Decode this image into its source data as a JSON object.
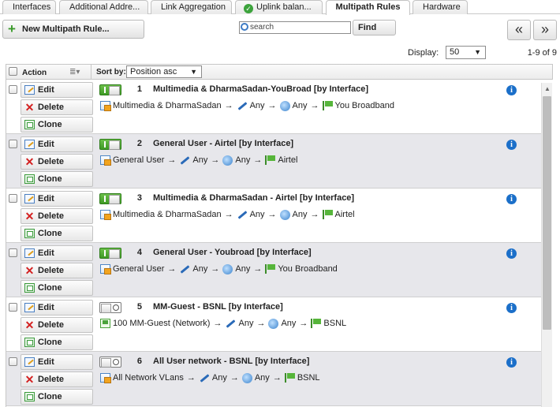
{
  "tabs": [
    {
      "label": "Interfaces"
    },
    {
      "label": "Additional Addre..."
    },
    {
      "label": "Link Aggregation"
    },
    {
      "label": "Uplink balan..."
    },
    {
      "label": "Multipath Rules"
    },
    {
      "label": "Hardware"
    }
  ],
  "toolbar": {
    "new_label": "New Multipath Rule...",
    "search_placeholder": "search",
    "find_label": "Find",
    "prev_label": "«",
    "next_label": "»",
    "display_label": "Display:",
    "display_value": "50",
    "count": "1-9 of 9"
  },
  "table": {
    "action_header": "Action",
    "sort_label": "Sort by:",
    "sort_value": "Position asc",
    "button_labels": {
      "edit": "Edit",
      "delete": "Delete",
      "clone": "Clone"
    },
    "rows": [
      {
        "num": "1",
        "title": "Multimedia & DharmaSadan-YouBroad [by Interface]",
        "enabled": true,
        "source": "Multimedia & DharmaSadan",
        "service": "Any",
        "destination": "Any",
        "gateway": "You Broadband",
        "source_icon": "group-icon"
      },
      {
        "num": "2",
        "title": "General User - Airtel [by Interface]",
        "enabled": true,
        "source": "General User",
        "service": "Any",
        "destination": "Any",
        "gateway": "Airtel",
        "source_icon": "group-icon"
      },
      {
        "num": "3",
        "title": "Multimedia & DharmaSadan - Airtel [by Interface]",
        "enabled": true,
        "source": "Multimedia & DharmaSadan",
        "service": "Any",
        "destination": "Any",
        "gateway": "Airtel",
        "source_icon": "group-icon"
      },
      {
        "num": "4",
        "title": "General User - Youbroad [by Interface]",
        "enabled": true,
        "source": "General User",
        "service": "Any",
        "destination": "Any",
        "gateway": "You Broadband",
        "source_icon": "group-icon"
      },
      {
        "num": "5",
        "title": "MM-Guest - BSNL [by Interface]",
        "enabled": false,
        "source": "100 MM-Guest (Network)",
        "service": "Any",
        "destination": "Any",
        "gateway": "BSNL",
        "source_icon": "network-icon"
      },
      {
        "num": "6",
        "title": "All User network - BSNL [by Interface]",
        "enabled": false,
        "source": "All Network VLans",
        "service": "Any",
        "destination": "Any",
        "gateway": "BSNL",
        "source_icon": "group-icon"
      }
    ]
  },
  "colors": {
    "accent": "#3f9a25",
    "info": "#1b6fc9",
    "row_alt": "#e7e7eb"
  }
}
